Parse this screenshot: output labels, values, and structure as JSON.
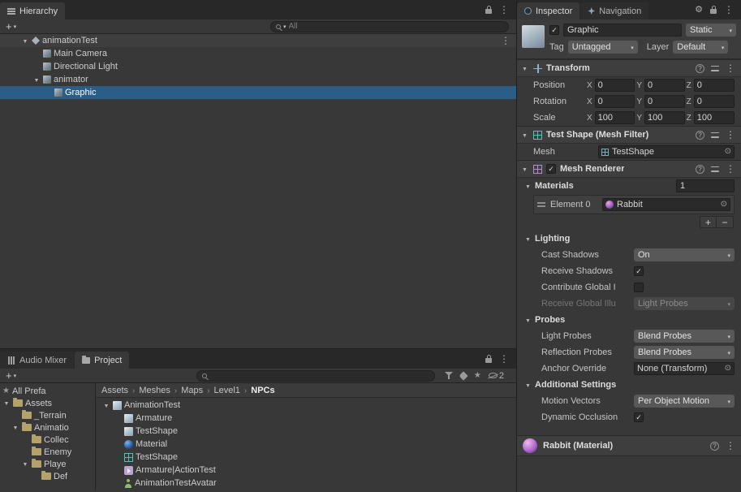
{
  "colors": {
    "selection": "#2c5d87"
  },
  "hierarchy": {
    "tab_label": "Hierarchy",
    "search_placeholder": "All",
    "items": [
      {
        "label": "animationTest"
      },
      {
        "label": "Main Camera"
      },
      {
        "label": "Directional Light"
      },
      {
        "label": "animator"
      },
      {
        "label": "Graphic"
      }
    ]
  },
  "project": {
    "tab_audio_mixer": "Audio Mixer",
    "tab_project": "Project",
    "hidden_count": "2",
    "favorites_item": "All Prefa",
    "folders": [
      {
        "label": "Assets"
      },
      {
        "label": "_Terrain"
      },
      {
        "label": "Animatio"
      },
      {
        "label": "Collec"
      },
      {
        "label": "Enemy"
      },
      {
        "label": "Playe"
      },
      {
        "label": "Def"
      }
    ],
    "breadcrumbs": [
      "Assets",
      "Meshes",
      "Maps",
      "Level1",
      "NPCs"
    ],
    "files": [
      {
        "label": "AnimationTest"
      },
      {
        "label": "Armature"
      },
      {
        "label": "TestShape"
      },
      {
        "label": "Material"
      },
      {
        "label": "TestShape"
      },
      {
        "label": "Armature|ActionTest"
      },
      {
        "label": "AnimationTestAvatar"
      }
    ]
  },
  "inspector": {
    "tab_inspector": "Inspector",
    "tab_navigation": "Navigation",
    "gameobject": {
      "name": "Graphic",
      "static": "Static",
      "tag_label": "Tag",
      "tag": "Untagged",
      "layer_label": "Layer",
      "layer": "Default"
    },
    "transform": {
      "title": "Transform",
      "axes": [
        "X",
        "Y",
        "Z"
      ],
      "rows": [
        {
          "label": "Position",
          "x": "0",
          "y": "0",
          "z": "0"
        },
        {
          "label": "Rotation",
          "x": "0",
          "y": "0",
          "z": "0"
        },
        {
          "label": "Scale",
          "x": "100",
          "y": "100",
          "z": "100"
        }
      ]
    },
    "mesh_filter": {
      "title": "Test Shape (Mesh Filter)",
      "mesh_label": "Mesh",
      "mesh_value": "TestShape"
    },
    "mesh_renderer": {
      "title": "Mesh Renderer",
      "materials_title": "Materials",
      "materials_count": "1",
      "element_label": "Element 0",
      "element_value": "Rabbit",
      "add_label": "+",
      "remove_label": "−",
      "lighting_title": "Lighting",
      "cast_shadows_label": "Cast Shadows",
      "cast_shadows_value": "On",
      "receive_shadows_label": "Receive Shadows",
      "contribute_gi_label": "Contribute Global I",
      "receive_gi_label": "Receive Global Illu",
      "receive_gi_value": "Light Probes",
      "probes_title": "Probes",
      "light_probes_label": "Light Probes",
      "light_probes_value": "Blend Probes",
      "reflection_probes_label": "Reflection Probes",
      "reflection_probes_value": "Blend Probes",
      "anchor_label": "Anchor Override",
      "anchor_value": "None (Transform)",
      "additional_title": "Additional Settings",
      "motion_vectors_label": "Motion Vectors",
      "motion_vectors_value": "Per Object Motion",
      "dynamic_occlusion_label": "Dynamic Occlusion"
    },
    "material_header": {
      "title": "Rabbit (Material)"
    }
  }
}
